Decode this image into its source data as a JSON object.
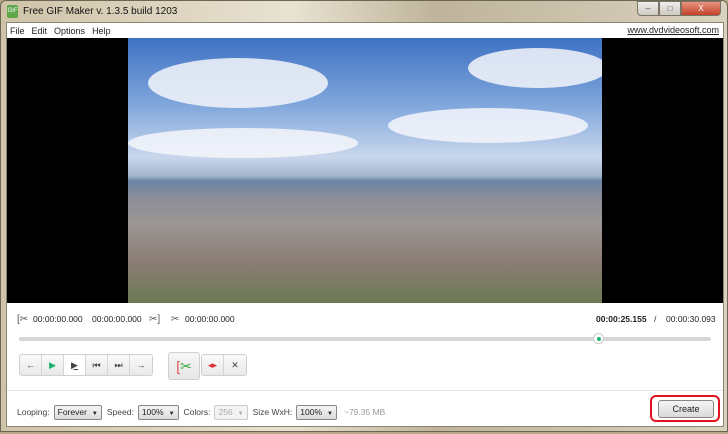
{
  "window": {
    "title": "Free GIF Maker v. 1.3.5 build 1203",
    "icon_text": "GIF",
    "min": "–",
    "max": "□",
    "close": "X"
  },
  "menu": {
    "items": [
      "File",
      "Edit",
      "Options",
      "Help"
    ],
    "site_link": "www.dvdvideosoft.com"
  },
  "times": {
    "start": "00:00:00.000",
    "end": "00:00:00.000",
    "duration": "00:00:00.000",
    "current": "00:00:25.155",
    "separator": "/",
    "total": "00:00:30.093"
  },
  "playback": {
    "progress": 0.836,
    "accent": "#1bb36e"
  },
  "controls": {
    "prev": "←",
    "play": "▶",
    "play_sel": "▶̲",
    "to_start": "⏮",
    "to_end": "⏭",
    "next": "→",
    "cut": "✂",
    "mark": "◂▸",
    "delete": "✕"
  },
  "settings": {
    "looping_label": "Looping:",
    "looping": "Forever",
    "speed_label": "Speed:",
    "speed": "100%",
    "colors_label": "Colors:",
    "colors": "256",
    "size_label": "Size WxH:",
    "size": "100%",
    "estimate": "~79.35 MB"
  },
  "create_label": "Create"
}
